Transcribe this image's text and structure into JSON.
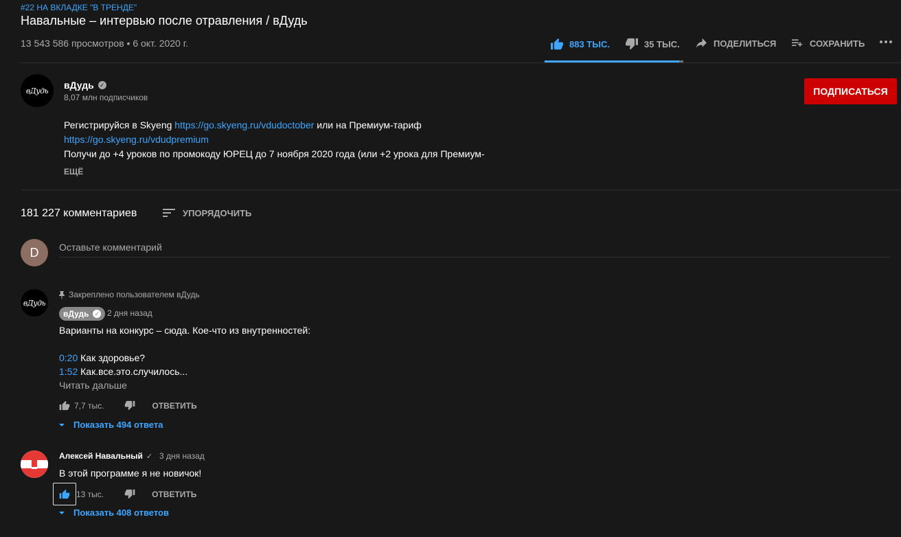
{
  "video": {
    "trend_badge": "#22 НА ВКЛАДКЕ \"В ТРЕНДЕ\"",
    "title": "Навальные – интервью после отравления / вДудь",
    "views_date": "13 543 586 просмотров • 6 окт. 2020 г.",
    "like_count": "883 ТЫС.",
    "dislike_count": "35 ТЫС.",
    "share_label": "ПОДЕЛИТЬСЯ",
    "save_label": "СОХРАНИТЬ",
    "like_ratio": 0.97
  },
  "channel": {
    "logo_text": "вДудь",
    "name": "вДудь",
    "subscribers": "8,07 млн подписчиков",
    "subscribe_label": "ПОДПИСАТЬСЯ"
  },
  "description": {
    "line1_text": "Регистрируйся в Skyeng ",
    "line1_link": "https://go.skyeng.ru/vdudoctober",
    "line1_tail": " или на Премиум-тариф",
    "line2_link": "https://go.skyeng.ru/vdudpremium",
    "line3_text": "Получи до +4 уроков по промокоду ЮРЕЦ до 7 ноября 2020 года (или +2 урока для Премиум-",
    "more_label": "ЕЩЁ"
  },
  "comments": {
    "count_label": "181 227 комментариев",
    "sort_label": "УПОРЯДОЧИТЬ",
    "my_avatar_letter": "D",
    "input_placeholder": "Оставьте комментарий",
    "items": [
      {
        "pinned_label": "Закреплено пользователем вДудь",
        "author": "вДудь",
        "time": "2 дня назад",
        "text": "Варианты на конкурс – сюда. Кое-что из внутренностей:",
        "timestamps": [
          {
            "time": "0:20",
            "label": " Как здоровье?"
          },
          {
            "time": "1:52",
            "label": " Как.все.это.случилось..."
          }
        ],
        "read_more": "Читать дальше",
        "likes": "7,7 тыс.",
        "reply_label": "ОТВЕТИТЬ",
        "replies_label": "Показать 494 ответа"
      },
      {
        "author": "Алексей Навальный",
        "check": "✓",
        "time": "3 дня назад",
        "text": "В этой программе я не новичок!",
        "likes": "13 тыс.",
        "reply_label": "ОТВЕТИТЬ",
        "replies_label": "Показать 408 ответов"
      }
    ]
  },
  "colors": {
    "background": "#181818",
    "accent": "#3ea6ff",
    "subscribe": "#cc0000",
    "muted": "#aaaaaa"
  },
  "icons": [
    "thumb-up-icon",
    "thumb-down-icon",
    "share-icon",
    "playlist-add-icon",
    "more-icon",
    "verified-icon",
    "sort-icon",
    "pin-icon",
    "caret-down-icon"
  ]
}
